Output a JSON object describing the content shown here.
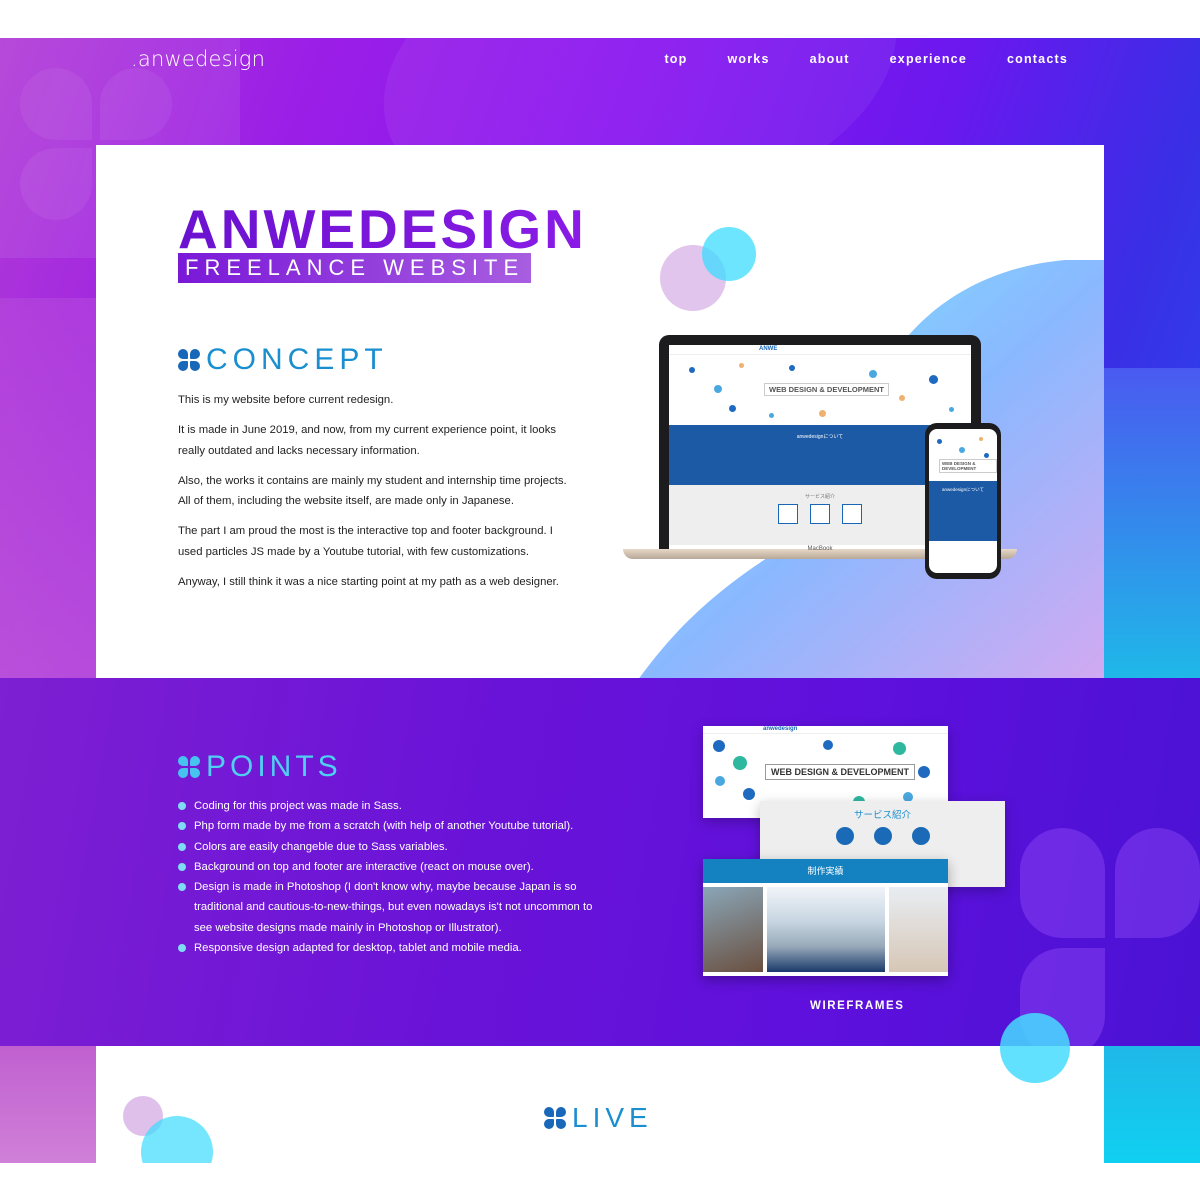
{
  "nav": {
    "logo": ".anwedesign",
    "links": [
      "top",
      "works",
      "about",
      "experience",
      "contacts"
    ]
  },
  "hero": {
    "title": "ANWEDESIGN",
    "subtitle": "FREELANCE WEBSITE"
  },
  "concept": {
    "heading": "CONCEPT",
    "paragraphs": [
      "This is my website before current redesign.",
      "It is made in June 2019, and now, from my current experience point, it looks really outdated and lacks necessary information.",
      "Also, the works it contains are mainly my student and internship time projects. All of them, including the website itself, are made only in Japanese.",
      "The part I am proud the most is the interactive top and footer background. I used particles JS made by a Youtube tutorial, with few customizations.",
      "Anyway, I still think it was a nice starting point at my path as a web designer."
    ]
  },
  "mockup": {
    "screen_badge": "WEB DESIGN & DEVELOPMENT",
    "screen_section": "anwedesignについて",
    "screen_services": "サービス紹介",
    "laptop_brand": "MacBook",
    "screen_logo": "ANWE"
  },
  "points": {
    "heading": "POINTS",
    "items": [
      "Coding for this project was made in Sass.",
      "Php form made by me from a scratch (with help of another Youtube tutorial).",
      "Colors are easily changeble due to Sass variables.",
      "Background on top and footer are interactive (react on mouse over).",
      "Design is made in Photoshop (I don't know why, maybe because Japan is so traditional and cautious-to-new-things, but even nowadays is't not uncommon to see website designs made mainly in Photoshop or Illustrator).",
      "Responsive design adapted for desktop, tablet and mobile media."
    ]
  },
  "wireframes": {
    "caption": "WIREFRAMES",
    "logo": "anwedesign",
    "badge": "WEB DESIGN & DEVELOPMENT",
    "services": "サービス紹介",
    "works": "制作実績"
  },
  "live": {
    "heading": "LIVE"
  },
  "colors": {
    "purple": "#7a13d8",
    "cyan": "#4fd0f2",
    "blue": "#1a8fd0"
  }
}
